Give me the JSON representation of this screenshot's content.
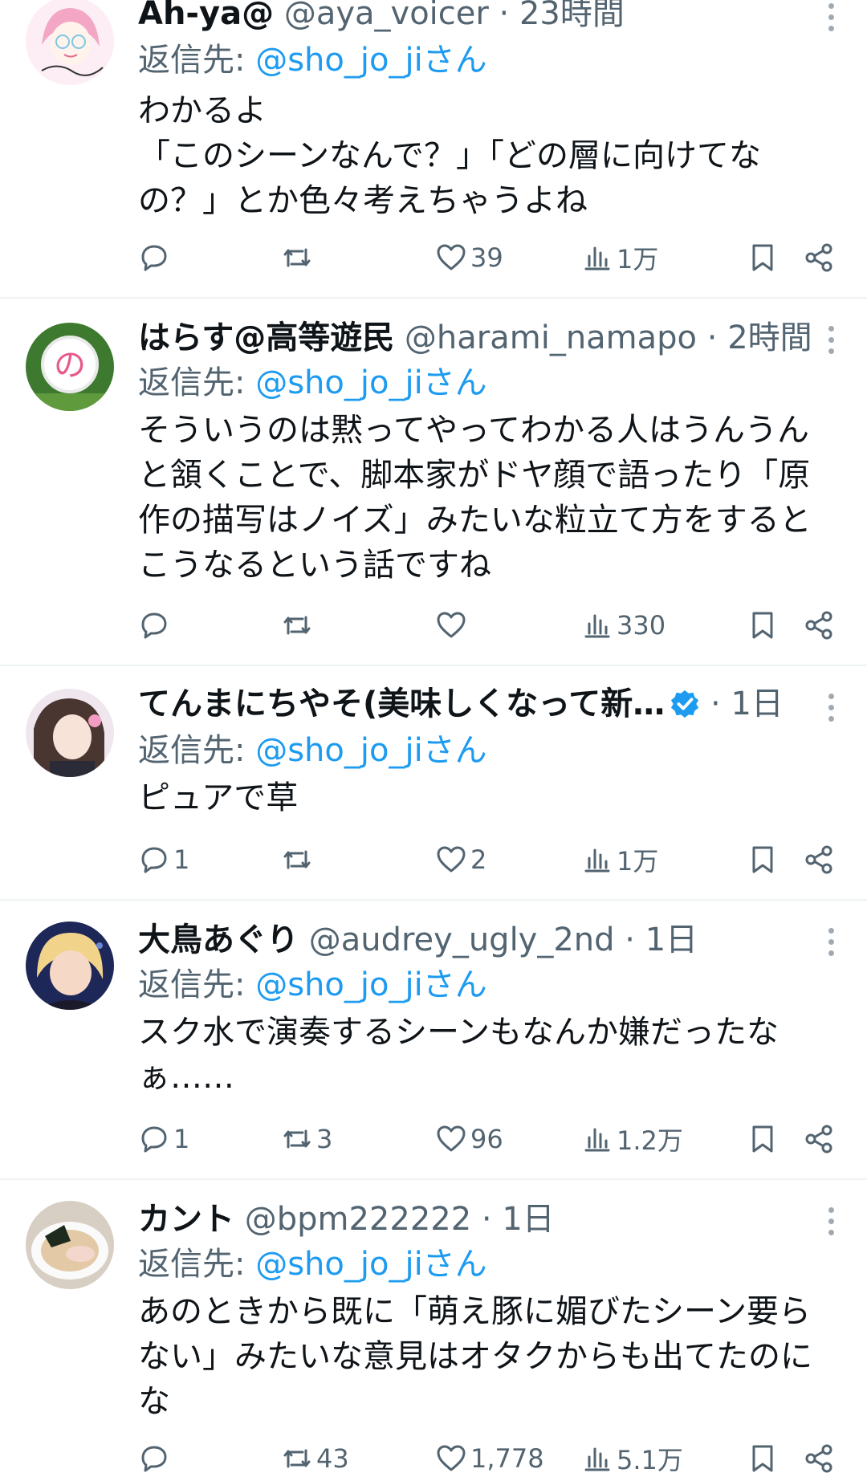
{
  "tweets": [
    {
      "name": "Ah-ya@",
      "handle": "@aya_voicer",
      "time": "23時間",
      "reply_prefix": "返信先: ",
      "reply_mention": "@sho_jo_jiさん",
      "text": "わかるよ\n「このシーンなんで？」「どの層に向けてなの？」とか色々考えちゃうよね",
      "replies": "",
      "retweets": "",
      "likes": "39",
      "views": "1万",
      "verified": false
    },
    {
      "name": "はらす@高等遊民",
      "handle": "@harami_namapo",
      "time": "2時間",
      "reply_prefix": "返信先: ",
      "reply_mention": "@sho_jo_jiさん",
      "text": "そういうのは黙ってやってわかる人はうんうんと頷くことで、脚本家がドヤ顔で語ったり「原作の描写はノイズ」みたいな粒立て方をするとこうなるという話ですね",
      "replies": "",
      "retweets": "",
      "likes": "",
      "views": "330",
      "verified": false
    },
    {
      "name": "てんまにちやそ(美味しくなって新…",
      "handle": "",
      "time": "1日",
      "reply_prefix": "返信先: ",
      "reply_mention": "@sho_jo_jiさん",
      "text": "ピュアで草",
      "replies": "1",
      "retweets": "",
      "likes": "2",
      "views": "1万",
      "verified": true
    },
    {
      "name": "大鳥あぐり",
      "handle": "@audrey_ugly_2nd",
      "time": "1日",
      "reply_prefix": "返信先: ",
      "reply_mention": "@sho_jo_jiさん",
      "text": "スク水で演奏するシーンもなんか嫌だったなぁ……",
      "replies": "1",
      "retweets": "3",
      "likes": "96",
      "views": "1.2万",
      "verified": false
    },
    {
      "name": "カント",
      "handle": "@bpm222222",
      "time": "1日",
      "reply_prefix": "返信先: ",
      "reply_mention": "@sho_jo_jiさん",
      "text": "あのときから既に「萌え豚に媚びたシーン要らない」みたいな意見はオタクからも出てたのにな",
      "replies": "",
      "retweets": "43",
      "likes": "1,778",
      "views": "5.1万",
      "verified": false
    }
  ],
  "separator": " · ",
  "colors": {
    "text": "#0f1419",
    "secondary": "#536471",
    "link": "#1d9bf0",
    "divider": "#eff3f4"
  },
  "icons": {
    "reply": "reply-icon",
    "retweet": "retweet-icon",
    "like": "heart-icon",
    "views": "views-icon",
    "bookmark": "bookmark-icon",
    "share": "share-icon",
    "more": "more-icon",
    "verified": "verified-badge-icon"
  }
}
